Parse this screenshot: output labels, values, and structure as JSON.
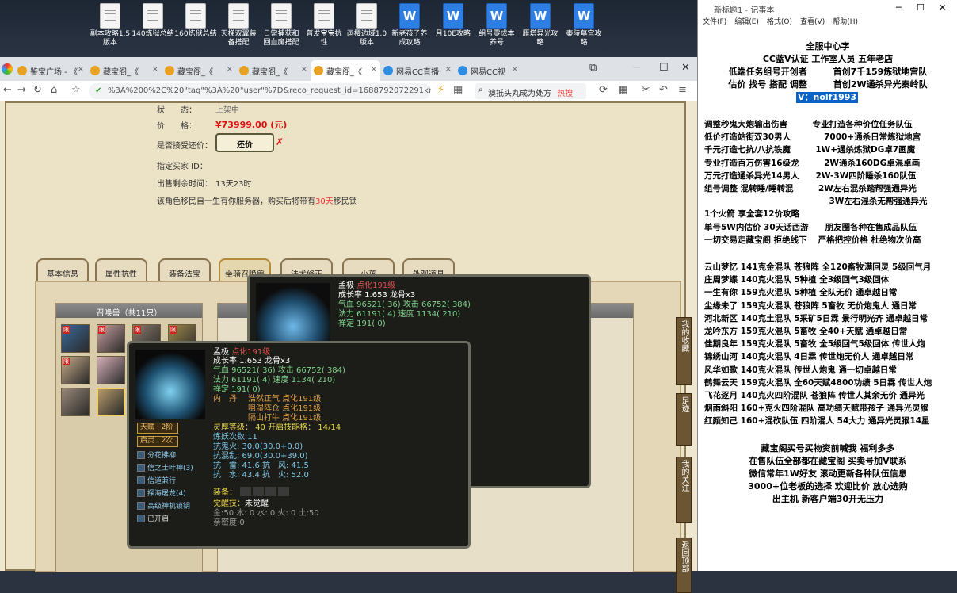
{
  "desktop": {
    "icons": [
      {
        "label": "副本攻略1.5\n版本",
        "kind": "doc"
      },
      {
        "label": "140炼狱总结",
        "kind": "doc"
      },
      {
        "label": "160炼狱总结",
        "kind": "doc"
      },
      {
        "label": "天梯双翼装\n备搭配",
        "kind": "doc"
      },
      {
        "label": "日常捕获和\n回血魔搭配",
        "kind": "doc"
      },
      {
        "label": "普发宝宝抗\n性",
        "kind": "doc"
      },
      {
        "label": "画樱边域1.0\n版本",
        "kind": "doc"
      },
      {
        "label": "新老孩子养\n成攻略",
        "kind": "wps"
      },
      {
        "label": "月10E攻略",
        "kind": "wps"
      },
      {
        "label": "组号零成本\n养号",
        "kind": "wps"
      },
      {
        "label": "雁塔异光攻\n略",
        "kind": "wps"
      },
      {
        "label": "秦陵墓宫攻\n略",
        "kind": "wps"
      }
    ]
  },
  "browser": {
    "tabs": [
      {
        "label": "鉴宝广场 - 《",
        "active": false
      },
      {
        "label": "藏宝阁_《",
        "active": false
      },
      {
        "label": "藏宝阁_《",
        "active": false
      },
      {
        "label": "藏宝阁_《",
        "active": false
      },
      {
        "label": "藏宝阁_《",
        "active": true
      },
      {
        "label": "网易CC直播",
        "active": false
      },
      {
        "label": "网易CC视",
        "active": false
      }
    ],
    "address": "%3A%200%2C%20\"tag\"%3A%20\"user\"%7D&reco_request_id=1688792072291kmxLK",
    "search_text": "澳抵头丸成为处方",
    "search_badge": "热搜"
  },
  "listing": {
    "status_label": "状　　态：",
    "status_value": "上架中",
    "price_label": "价　　格：",
    "price_value": "¥73999.00 (元)",
    "counter_label": "是否接受还价：",
    "counter_button": "还价",
    "buyer_label": "指定买家 ID：",
    "time_label": "出售剩余时间：",
    "time_value": "13天23时",
    "transfer_note_pre": "该角色移民自一生有你服务器，购买后将带有",
    "transfer_note_fee": "30天",
    "transfer_note_post": "移民锁"
  },
  "game_tabs": [
    "基本信息",
    "属性抗性",
    "装备法宝",
    "坐骑召唤兽",
    "法术修正",
    "小孩",
    "外观道具"
  ],
  "pet_panel": {
    "title": "召唤兽（共11只）",
    "limit_badge": "限"
  },
  "main_panel": {
    "title": "孟极"
  },
  "pet_detail": {
    "name": "孟极",
    "tag": "点化191级",
    "growth": "成长率 1.653 龙骨x3",
    "hp": "气血 96521( 36) 攻击 66752( 384)",
    "mp": "法力 61191( 4) 速度 1134( 210)",
    "hit": "禅定 191( 0)",
    "neidan_label": "内　丹",
    "neidan": [
      "浩然正气 点化191级",
      "咀湿阵仓 点化191级",
      "隔山打牛 点化191级"
    ],
    "level": "灵厚等级： 40 开启技能格： 14/14",
    "yao": "炼妖次数 11",
    "res1": "抗鬼火: 30.0(30.0+0.0)",
    "res2": "抗混乱: 69.0(30.0+39.0)",
    "res3": "抗　雷: 41.6 抗　风: 41.5",
    "res4": "抗　水: 43.4 抗　火: 52.0",
    "equip": "装备：",
    "awaken_label": "觉醒技：",
    "awaken_value": "未觉醒",
    "elements": "金:50 木: 0 水: 0 火: 0 土:50",
    "affinity": "亲密度:0",
    "talent1": "天赋 · 2阶",
    "talent2": "启灵 · 2次",
    "skills": [
      "分花拂柳",
      "信之士叶神(3)",
      "信道兼行",
      "探海屠龙(4)",
      "高级神机锁钥",
      "已开启"
    ]
  },
  "side_buttons": [
    "我的收藏",
    "足迹",
    "我的关注",
    "返回顶部"
  ],
  "notepad": {
    "title": "新标题1 - 记事本",
    "menu": [
      "文件(F)",
      "编辑(E)",
      "格式(O)",
      "查看(V)",
      "帮助(H)"
    ],
    "lines": [
      "全服中心字",
      "CC蓝V认证 工作室人员 五年老店",
      "低端任务组号开创者　　　首创7千159炼狱地宫队",
      "估价 找号 搭配 调整　　　首创2W通杀异光秦岭队",
      "V：nolf1993",
      "",
      "调整秒鬼大炮输出伤害　　　专业打造各种价位任务队伍",
      "低价打造站街双30男人　　　　7000+通杀日常炼狱地宫",
      "千元打造七抗/八抗铁魔　　　1W+通杀炼狱DG卓7画魔",
      "专业打造百万伤害16级龙　　　2W通杀160DG卓混卓画",
      "万元打造通杀异光14男人　　2W-3W四阶睡杀160队伍",
      "组号调整 混转睡/睡转混　　　2W左右混杀踏帮强通异光",
      "　　　　　　　　　　　　　　　3W左右混杀无帮强通异光",
      "1个火箭 享全套12价攻略",
      "单号5W内估价 30天话西游　　朋友圈各种在售成品队伍",
      "一切交易走藏宝阁 拒绝线下　 严格把控价格 杜绝物次价高",
      "",
      "云山梦忆 141克金混队 苍狼阵 全120畜牧满回灵 5级回气月",
      "庄周梦蝶 140克火混队 5种植 全3级回气3级回体",
      "一生有你 159克火混队 5种植 全队无价 通卓越日常",
      "尘缘未了 159克火混队 苍狼阵 5畜牧 无价炮鬼人 通日常",
      "河北新区 140克土混队 5采矿5日霖 景行明光齐 通卓越日常",
      "龙吟东方 159克火混队 5畜牧 全40+天赋 通卓越日常",
      "佳期良年 159克火混队 5畜牧 全5级回气5级回体 传世人炮",
      "锦绣山河 140克火混队 4日霖 传世炮无价人 通卓越日常",
      "风华如歌 140克火混队 传世人炮鬼 通一切卓越日常",
      "鹤舞云天 159克火混队 全60天赋4800功绩 5日霖 传世人炮",
      "飞花逐月 140克火四阶混队 苍狼阵 传世人其余无价 通异光",
      "烟雨斜阳 160+克火四阶混队 高功绩天赋带孩子 通异光灵猴",
      "红颜知己 160+混砍队伍 四阶混人 54大力 通异光灵猴14星",
      "",
      "藏宝阁买号买物资前喊我 福利多多",
      "在售队伍全部都在藏宝阁 买卖号加V联系",
      "微信常年1W好友 滚动更新各种队伍信息",
      "3000+位老板的选择 欢迎比价 放心选购",
      "出主机 新客户端30开无压力"
    ]
  }
}
